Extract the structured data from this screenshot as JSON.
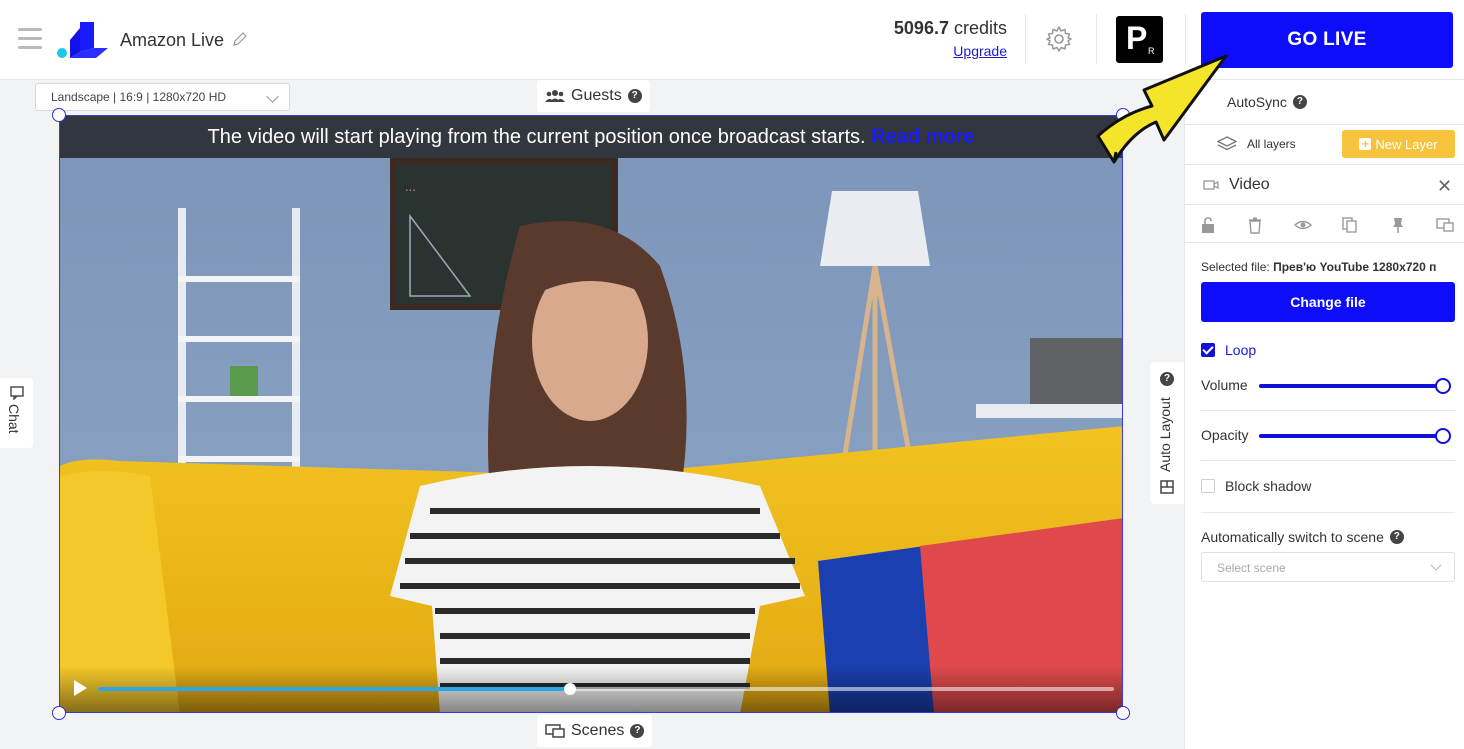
{
  "header": {
    "title": "Amazon Live",
    "credits_amount": "5096.7",
    "credits_unit": "credits",
    "upgrade_label": "Upgrade",
    "go_live_label": "GO LIVE",
    "avatar_letter": "P",
    "avatar_sub": "R"
  },
  "canvas": {
    "format_select": "Landscape | 16:9 | 1280x720 HD",
    "guests_label": "Guests",
    "scenes_label": "Scenes",
    "chat_label": "Chat",
    "auto_layout_label": "Auto Layout",
    "banner_text": "The video will start playing from the current position once broadcast starts.",
    "banner_link": "Read more",
    "video_progress": 0.465
  },
  "panel": {
    "autosync_label": "AutoSync",
    "all_layers_label": "All layers",
    "new_layer_label": "New Layer",
    "layer_title": "Video",
    "selected_file_label": "Selected file:",
    "selected_file_name": "Прев'ю YouTube 1280x720 п",
    "change_file_label": "Change file",
    "loop_label": "Loop",
    "loop_checked": true,
    "volume_label": "Volume",
    "volume_value": 1.0,
    "opacity_label": "Opacity",
    "opacity_value": 1.0,
    "block_shadow_label": "Block shadow",
    "block_shadow_checked": false,
    "auto_switch_label": "Automatically switch to scene",
    "scene_placeholder": "Select scene"
  },
  "colors": {
    "accent": "#0d0dfb",
    "new_layer": "#f7c23c",
    "seek": "#2ea6e6",
    "arrow": "#f5e52a"
  }
}
